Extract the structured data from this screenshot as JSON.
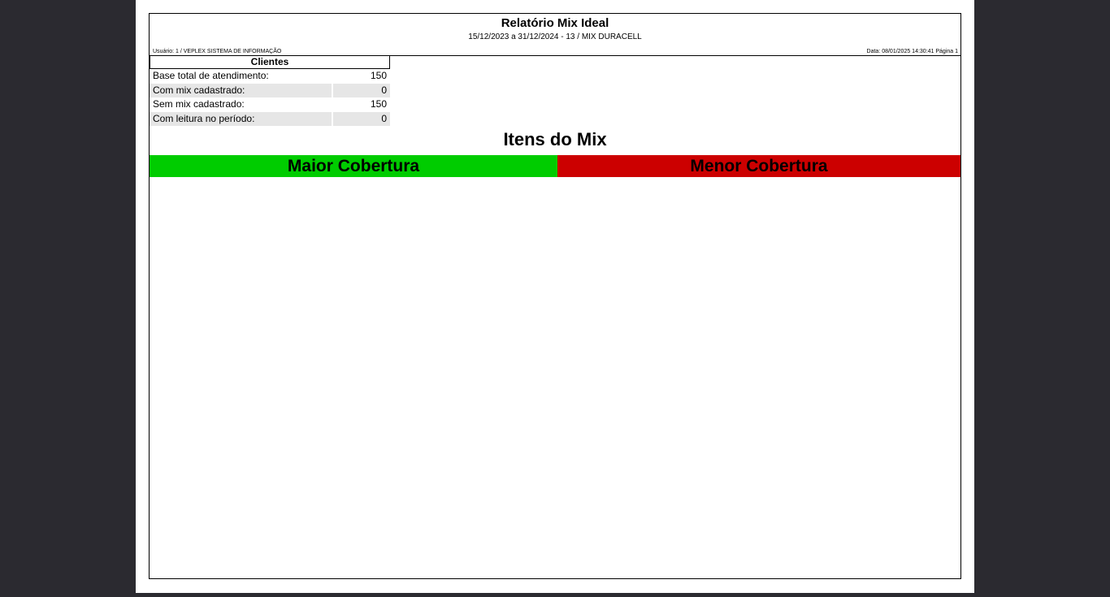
{
  "report": {
    "title": "Relatório Mix Ideal",
    "subtitle": "15/12/2023 a 31/12/2024 - 13 / MIX DURACELL",
    "user_line": "Usuário: 1 / VEPLEX SISTEMA DE INFORMAÇÃO",
    "date_line": "Data: 08/01/2025 14:30:41 Página 1"
  },
  "clients": {
    "header": "Clientes",
    "rows": [
      {
        "label": "Base total de atendimento:",
        "value": "150"
      },
      {
        "label": "Com mix cadastrado:",
        "value": "0"
      },
      {
        "label": "Sem mix cadastrado:",
        "value": "150"
      },
      {
        "label": "Com leitura no período:",
        "value": "0"
      }
    ]
  },
  "mix": {
    "title": "Itens do Mix",
    "high_label": "Maior Cobertura",
    "low_label": "Menor Cobertura",
    "high_color": "#00cc00",
    "low_color": "#cc0000"
  }
}
